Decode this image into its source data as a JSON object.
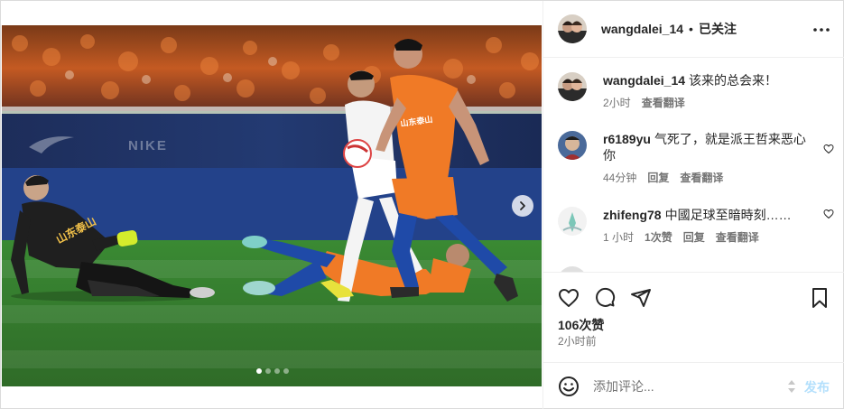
{
  "post": {
    "author": "wangdalei_14",
    "separator": "•",
    "follow_status": "已关注",
    "likes": "106次赞",
    "time_ago": "2小时前",
    "carousel": {
      "total_slides": 4,
      "active_slide": 1
    }
  },
  "comments": [
    {
      "user": "wangdalei_14",
      "text": "该来的总会来！",
      "time": "2小时",
      "actions": [
        "查看翻译"
      ],
      "has_like": false
    },
    {
      "user": "r6189yu",
      "text": "气死了，就是派王哲来恶心你",
      "time": "44分钟",
      "actions": [
        "回复",
        "查看翻译"
      ],
      "has_like": true
    },
    {
      "user": "zhifeng78",
      "text": "中國足球至暗時刻……",
      "time": "1 小时",
      "actions": [
        "1次赞",
        "回复",
        "查看翻译"
      ],
      "has_like": true
    }
  ],
  "composer": {
    "placeholder": "添加评论...",
    "post_label": "发布"
  },
  "photo_text": {
    "jersey_sponsor_keeper": "山东泰山",
    "board_brand": "NIKE"
  },
  "colors": {
    "text": "#262626",
    "secondary": "#737373",
    "post_button_disabled": "#b2dffc",
    "border": "#efefef",
    "orange_kit": "#f07a26",
    "pitch": "#3e7d2f"
  },
  "icons": [
    "more-horizontal-icon",
    "heart-icon",
    "comment-icon",
    "share-icon",
    "save-icon",
    "emoji-icon",
    "chevron-right-icon"
  ]
}
